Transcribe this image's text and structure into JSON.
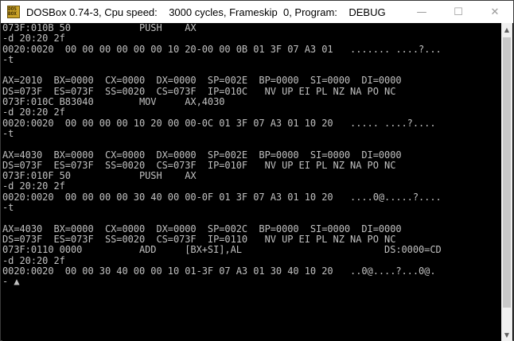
{
  "window": {
    "title": "DOSBox 0.74-3, Cpu speed:    3000 cycles, Frameskip  0, Program:    DEBUG",
    "icon_label": "DOS BOX",
    "minimize_glyph": "—",
    "maximize_glyph": "☐",
    "close_glyph": "✕"
  },
  "terminal": {
    "lines": [
      "073F:010B 50            PUSH    AX",
      "-d 20:20 2f",
      "0020:0020  00 00 00 00 00 00 10 20-00 00 0B 01 3F 07 A3 01   ....... ....?...",
      "-t",
      "",
      "AX=2010  BX=0000  CX=0000  DX=0000  SP=002E  BP=0000  SI=0000  DI=0000",
      "DS=073F  ES=073F  SS=0020  CS=073F  IP=010C   NV UP EI PL NZ NA PO NC",
      "073F:010C B83040        MOV     AX,4030",
      "-d 20:20 2f",
      "0020:0020  00 00 00 00 10 20 00 00-0C 01 3F 07 A3 01 10 20   ..... ....?....",
      "-t",
      "",
      "AX=4030  BX=0000  CX=0000  DX=0000  SP=002E  BP=0000  SI=0000  DI=0000",
      "DS=073F  ES=073F  SS=0020  CS=073F  IP=010F   NV UP EI PL NZ NA PO NC",
      "073F:010F 50            PUSH    AX",
      "-d 20:20 2f",
      "0020:0020  00 00 00 00 30 40 00 00-0F 01 3F 07 A3 01 10 20   ....0@.....?....",
      "-t",
      "",
      "AX=4030  BX=0000  CX=0000  DX=0000  SP=002C  BP=0000  SI=0000  DI=0000",
      "DS=073F  ES=073F  SS=0020  CS=073F  IP=0110   NV UP EI PL NZ NA PO NC",
      "073F:0110 0000          ADD     [BX+SI],AL                         DS:0000=CD",
      "-d 20:20 2f",
      "0020:0020  00 00 30 40 00 00 10 01-3F 07 A3 01 30 40 10 20   ..0@....?...0@.",
      "- ▲"
    ]
  },
  "scrollbar": {
    "up_glyph": "▲",
    "down_glyph": "▼"
  }
}
